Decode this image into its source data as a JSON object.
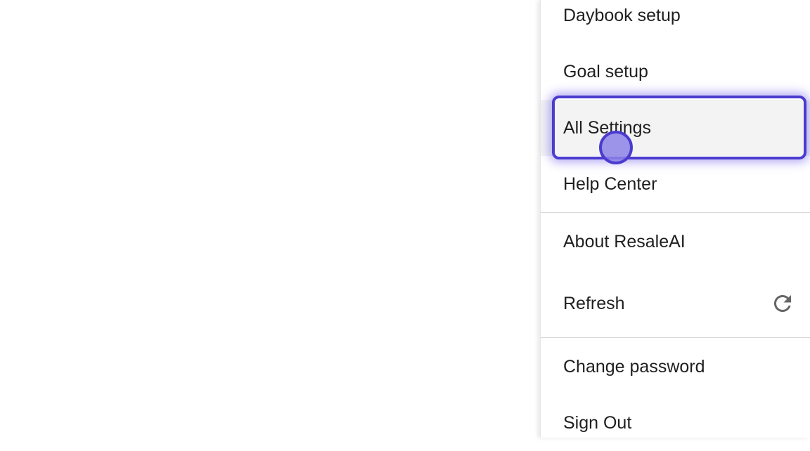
{
  "menu": {
    "items": [
      {
        "label": "Daybook setup"
      },
      {
        "label": "Goal setup"
      },
      {
        "label": "All Settings"
      },
      {
        "label": "Help Center"
      },
      {
        "label": "About ResaleAI"
      },
      {
        "label": "Refresh",
        "icon": "refresh-icon"
      },
      {
        "label": "Change password"
      },
      {
        "label": "Sign Out"
      }
    ],
    "highlighted_item": "All Settings"
  },
  "colors": {
    "highlight": "#4b3ccf",
    "hover_background": "#f3f3f3",
    "text": "#1f1f1f",
    "icon": "#666666"
  }
}
